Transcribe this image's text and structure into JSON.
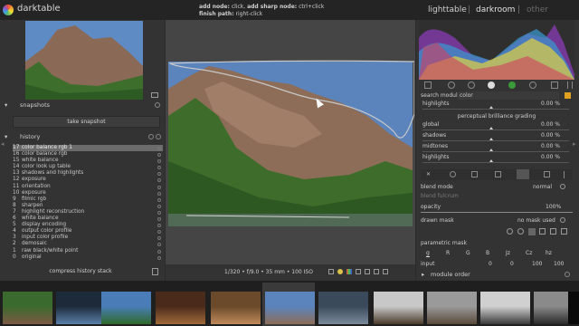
{
  "app": {
    "name": "darktable"
  },
  "hints": {
    "add_node_key": "add node:",
    "add_node_action": "click,",
    "add_sharp_key": "add sharp node:",
    "add_sharp_action": "ctrl+click",
    "finish_key": "finish path:",
    "finish_action": "right-click"
  },
  "views": {
    "lighttable": "lighttable",
    "sep1": "|",
    "darkroom": "darkroom",
    "sep2": "|",
    "other": "other"
  },
  "left": {
    "snapshots_title": "snapshots",
    "take_snapshot": "take snapshot",
    "history_title": "history",
    "history_items": [
      {
        "num": "17",
        "label": "color balance rgb 1"
      },
      {
        "num": "16",
        "label": "color balance rgb"
      },
      {
        "num": "15",
        "label": "white balance"
      },
      {
        "num": "14",
        "label": "color look up table"
      },
      {
        "num": "13",
        "label": "shadows and highlights"
      },
      {
        "num": "12",
        "label": "exposure"
      },
      {
        "num": "11",
        "label": "orientation"
      },
      {
        "num": "10",
        "label": "exposure"
      },
      {
        "num": "9",
        "label": "filmic rgb"
      },
      {
        "num": "8",
        "label": "sharpen"
      },
      {
        "num": "7",
        "label": "highlight reconstruction"
      },
      {
        "num": "6",
        "label": "white balance"
      },
      {
        "num": "5",
        "label": "display encoding"
      },
      {
        "num": "4",
        "label": "output color profile"
      },
      {
        "num": "3",
        "label": "input color profile"
      },
      {
        "num": "2",
        "label": "demosaic"
      },
      {
        "num": "1",
        "label": "raw black/white point"
      },
      {
        "num": "0",
        "label": "original"
      }
    ],
    "compress_history": "compress history stack"
  },
  "center": {
    "image_info": "1/320 • f/9.0 • 35 mm • 100 ISO"
  },
  "right": {
    "search_label": "search module",
    "search_value": "color",
    "top_rows": [
      {
        "label": "highlights",
        "value": "0.00 %"
      }
    ],
    "grading_title": "perceptual brilliance grading",
    "grading_rows": [
      {
        "label": "global",
        "value": "0.00 %"
      },
      {
        "label": "shadows",
        "value": "0.00 %"
      },
      {
        "label": "midtones",
        "value": "0.00 %"
      },
      {
        "label": "highlights",
        "value": "0.00 %"
      }
    ],
    "blend_mode_label": "blend mode",
    "blend_mode_value": "normal",
    "blend_fulcrum_label": "blend fulcrum",
    "opacity_label": "opacity",
    "opacity_value": "100%",
    "drawn_mask_label": "drawn mask",
    "drawn_mask_value": "no mask used",
    "parametric_mask_label": "parametric mask",
    "channel_tabs": [
      "g",
      "R",
      "G",
      "B",
      "Jz",
      "Cz",
      "hz"
    ],
    "input_label": "input",
    "input_values": [
      "0",
      "0",
      "100",
      "100"
    ],
    "module_order": "module order"
  },
  "colors": {
    "panel": "#333333",
    "center": "#454545",
    "active_history": "#6b6b6b"
  }
}
